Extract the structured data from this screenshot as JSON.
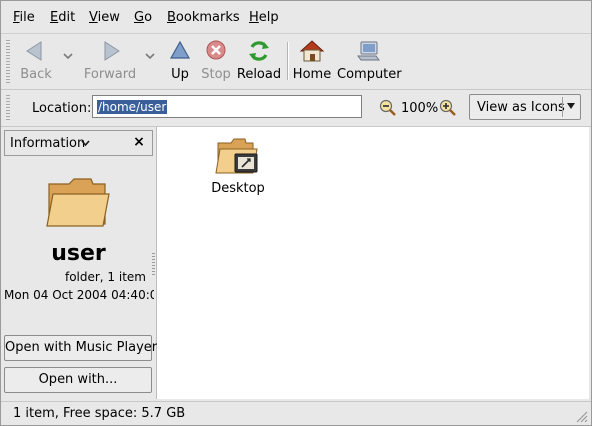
{
  "menubar": {
    "items": [
      {
        "label": "File",
        "mnemonic": "F",
        "rest": "ile"
      },
      {
        "label": "Edit",
        "mnemonic": "E",
        "rest": "dit"
      },
      {
        "label": "View",
        "mnemonic": "V",
        "rest": "iew"
      },
      {
        "label": "Go",
        "mnemonic": "G",
        "rest": "o"
      },
      {
        "label": "Bookmarks",
        "mnemonic": "B",
        "rest": "ookmarks"
      },
      {
        "label": "Help",
        "mnemonic": "H",
        "rest": "elp"
      }
    ]
  },
  "toolbar": {
    "back": {
      "label": "Back",
      "icon": "back-arrow-icon",
      "enabled": false
    },
    "forward": {
      "label": "Forward",
      "icon": "forward-arrow-icon",
      "enabled": false
    },
    "up": {
      "label": "Up",
      "icon": "up-arrow-icon",
      "enabled": true
    },
    "stop": {
      "label": "Stop",
      "icon": "stop-icon",
      "enabled": false
    },
    "reload": {
      "label": "Reload",
      "icon": "reload-icon",
      "enabled": true
    },
    "home": {
      "label": "Home",
      "icon": "home-icon",
      "enabled": true
    },
    "computer": {
      "label": "Computer",
      "icon": "computer-icon",
      "enabled": true
    }
  },
  "location": {
    "label": "Location:",
    "value": "/home/user",
    "zoom": "100%",
    "view_mode": "View as Icons"
  },
  "sidebar": {
    "title": "Information",
    "close_glyph": "×",
    "name": "user",
    "subtitle": "folder, 1 item",
    "date": "Mon 04 Oct 2004 04:40:0",
    "buttons": [
      "Open with Music Player",
      "Open with..."
    ]
  },
  "content": {
    "items": [
      {
        "label": "Desktop",
        "icon": "desktop-folder-icon"
      }
    ]
  },
  "status": {
    "text": "1 item, Free space: 5.7 GB"
  },
  "colors": {
    "selection": "#3a5f9a",
    "folder": "#e8b76a",
    "home_roof": "#b33a1a",
    "reload": "#2f9a2f",
    "stop": "#c23a3a"
  }
}
